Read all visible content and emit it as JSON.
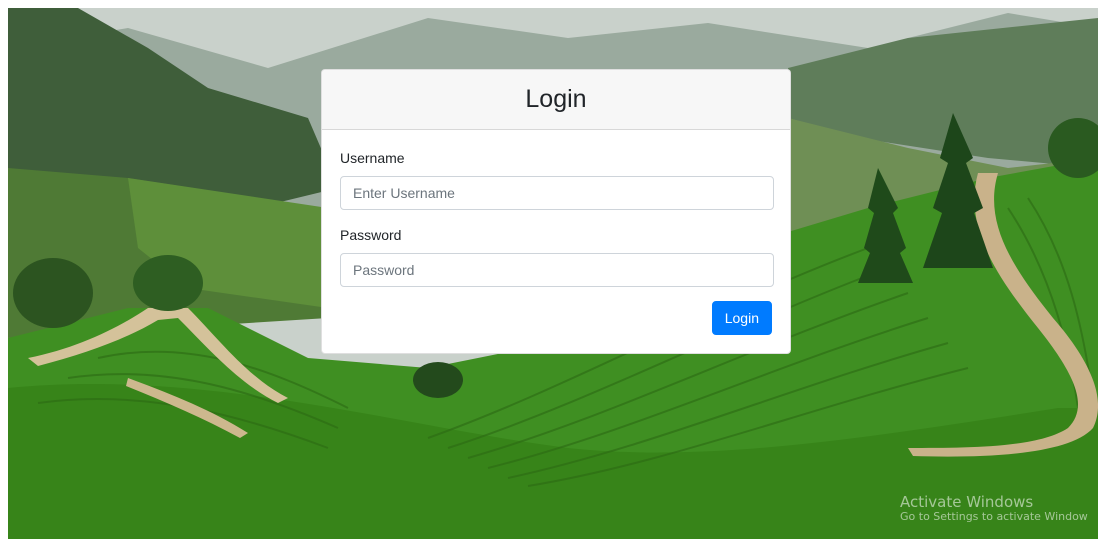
{
  "login_card": {
    "title": "Login",
    "username": {
      "label": "Username",
      "placeholder": "Enter Username",
      "value": ""
    },
    "password": {
      "label": "Password",
      "placeholder": "Password",
      "value": ""
    },
    "submit_label": "Login"
  },
  "watermark": {
    "title": "Activate Windows",
    "subtitle": "Go to Settings to activate Window"
  },
  "colors": {
    "primary": "#007bff",
    "card_header_bg": "#f7f7f7",
    "background_green": "#3f8f22"
  },
  "background": {
    "subject": "tea-plantation-hills"
  }
}
